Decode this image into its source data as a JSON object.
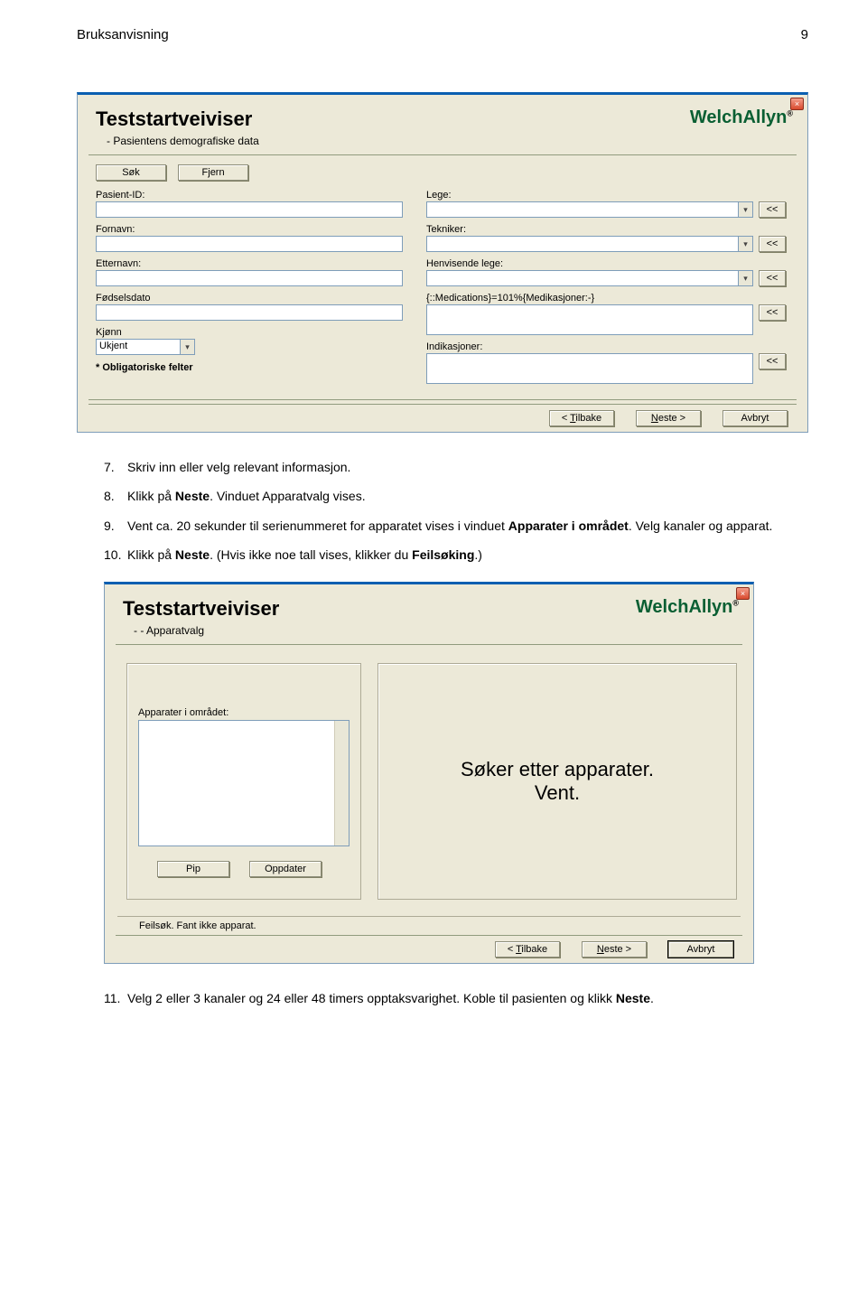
{
  "page": {
    "header_left": "Bruksanvisning",
    "header_right": "9"
  },
  "steps": {
    "s7": {
      "num": "7.",
      "text_a": "Skriv inn eller velg relevant informasjon."
    },
    "s8": {
      "num": "8.",
      "text_a": "Klikk på ",
      "bold": "Neste",
      "text_b": ". Vinduet Apparatvalg vises."
    },
    "s9": {
      "num": "9.",
      "text_a": "Vent ca. 20 sekunder til serienummeret for apparatet vises i vinduet ",
      "bold": "Apparater i området",
      "text_b": ". Velg kanaler og apparat."
    },
    "s10": {
      "num": "10.",
      "text_a": "Klikk på ",
      "bold": "Neste",
      "text_b": ". (Hvis ikke noe tall vises, klikker du ",
      "bold2": "Feilsøking",
      "text_c": ".)"
    },
    "s11": {
      "num": "11.",
      "text_a": "Velg 2 eller 3 kanaler og 24 eller 48 timers opptaksvarighet. Koble til pasienten og klikk ",
      "bold": "Neste",
      "text_b": "."
    }
  },
  "win1": {
    "title": "Teststartveiviser",
    "subtitle": "- Pasientens demografiske data",
    "close": "×",
    "btn_sok": "Søk",
    "btn_fjern": "Fjern",
    "lbl_pasientid": "Pasient-ID:",
    "lbl_fornavn": "Fornavn:",
    "lbl_etternavn": "Etternavn:",
    "lbl_fodsel": "Fødselsdato",
    "lbl_kjonn": "Kjønn",
    "val_kjonn": "Ukjent",
    "lbl_lege": "Lege:",
    "lbl_tekniker": "Tekniker:",
    "lbl_henv": "Henvisende lege:",
    "lbl_med": "{::Medications}=101%{Medikasjoner:-}",
    "lbl_indik": "Indikasjoner:",
    "btn_ll": "<<",
    "oblig": "* Obligatoriske felter",
    "btn_tilbake": "< Tilbake",
    "btn_neste": "Neste >",
    "btn_avbryt": "Avbryt",
    "tilbake_u": "T",
    "neste_u": "N"
  },
  "win2": {
    "title": "Teststartveiviser",
    "subtitle": "- - Apparatvalg",
    "close": "×",
    "lbl_list": "Apparater i området:",
    "btn_pip": "Pip",
    "btn_oppdater": "Oppdater",
    "search1": "Søker etter apparater.",
    "search2": "Vent.",
    "feil": "Feilsøk. Fant ikke apparat.",
    "btn_tilbake": "< Tilbake",
    "btn_neste": "Neste >",
    "btn_avbryt": "Avbryt"
  },
  "logo": {
    "text": "WelchAllyn",
    "reg": "®"
  }
}
